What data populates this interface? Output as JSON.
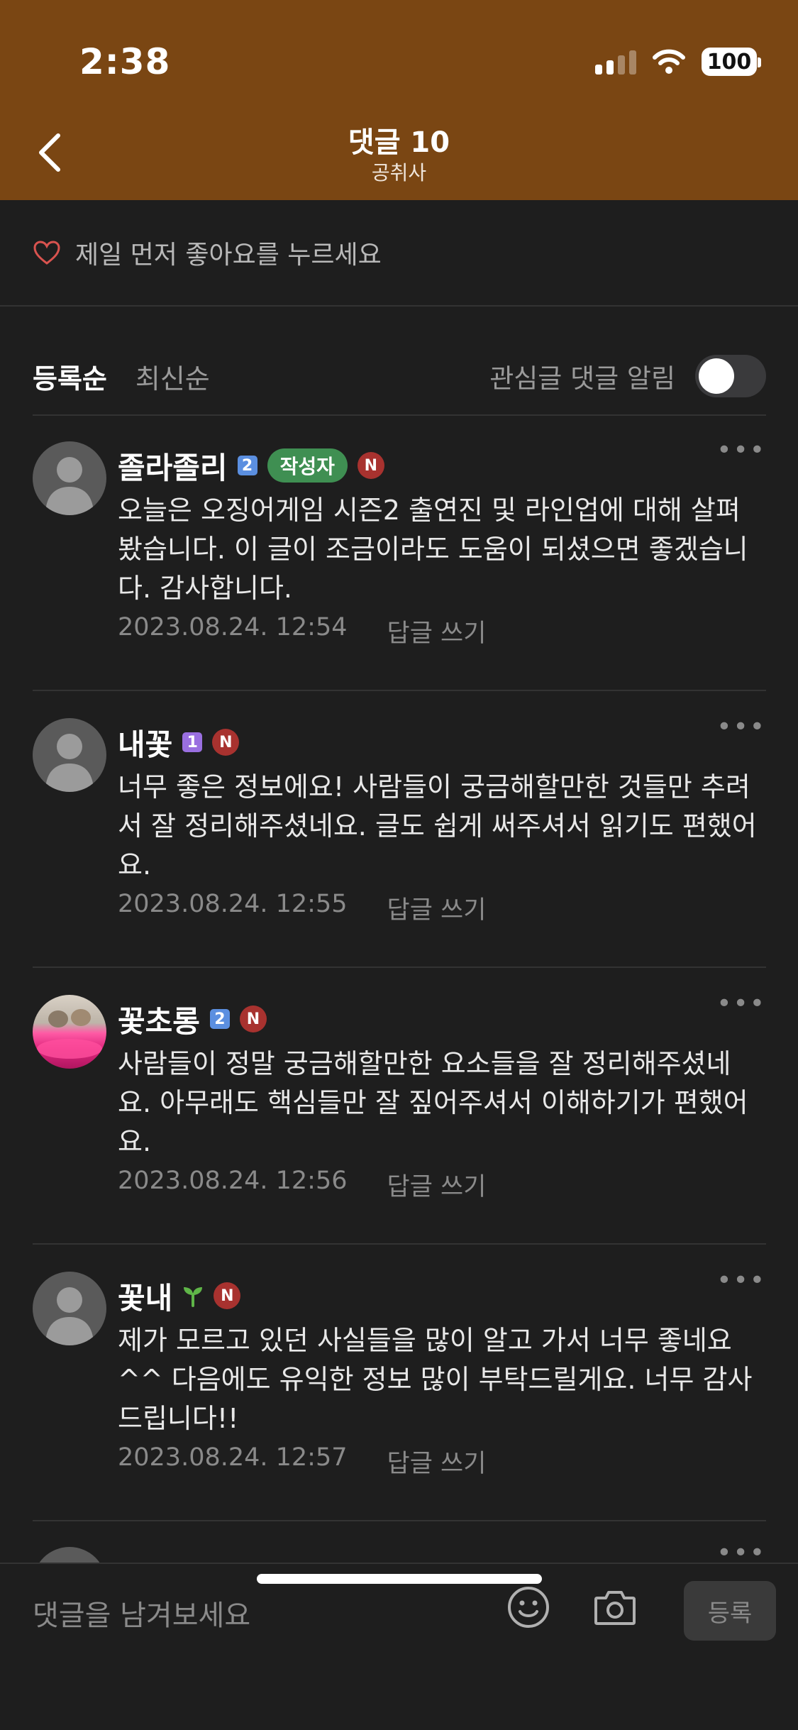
{
  "status": {
    "time": "2:38",
    "battery": "100"
  },
  "header": {
    "title": "댓글 10",
    "subtitle": "공취사"
  },
  "likes": {
    "text": "제일 먼저 좋아요를 누르세요"
  },
  "sort": {
    "option1": "등록순",
    "option2": "최신순",
    "notify_label": "관심글 댓글 알림",
    "notify_on": false
  },
  "comments": [
    {
      "name": "졸라졸리",
      "level": "2",
      "writer": "작성자",
      "badge": "N",
      "text": "오늘은 오징어게임 시즌2 출연진 및 라인업에 대해 살펴봤습니다. 이 글이 조금이라도 도움이 되셨으면 좋겠습니다. 감사합니다.",
      "date": "2023.08.24. 12:54",
      "reply": "답글 쓰기"
    },
    {
      "name": "내꽃",
      "level": "1",
      "badge": "N",
      "text": "너무 좋은 정보에요! 사람들이 궁금해할만한 것들만 추려서 잘 정리해주셨네요. 글도 쉽게 써주셔서 읽기도 편했어요.",
      "date": "2023.08.24. 12:55",
      "reply": "답글 쓰기"
    },
    {
      "name": "꽃초롱",
      "level": "2",
      "badge": "N",
      "text": "사람들이 정말 궁금해할만한 요소들을 잘 정리해주셨네요. 아무래도 핵심들만 잘 짚어주셔서 이해하기가 편했어요.",
      "date": "2023.08.24. 12:56",
      "reply": "답글 쓰기"
    },
    {
      "name": "꽃내",
      "badge": "N",
      "text": "제가 모르고 있던 사실들을 많이 알고 가서 너무 좋네요^^ 다음에도 유익한 정보 많이 부탁드릴게요. 너무 감사드립니다!!",
      "date": "2023.08.24. 12:57",
      "reply": "답글 쓰기"
    }
  ],
  "more_glyph": "•••",
  "bottom": {
    "placeholder": "댓글을 남겨보세요",
    "submit": "등록"
  },
  "colors": {
    "header": "#7a4613",
    "background": "#1e1e1e",
    "writer_badge": "#3f8f52",
    "n_badge": "#a8322f",
    "level1": "#9a6fe0",
    "level2": "#5b8fe0"
  }
}
